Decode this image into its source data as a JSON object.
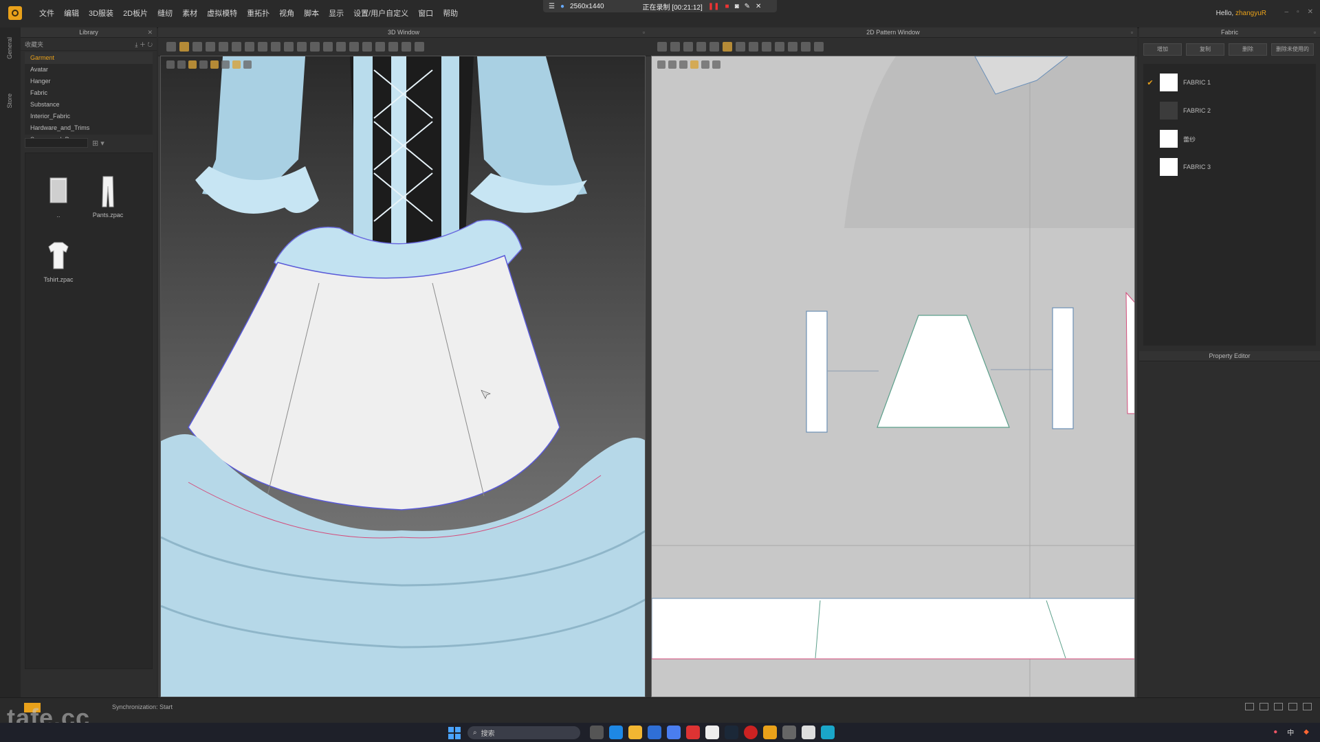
{
  "titlebar": {
    "menu": [
      "文件",
      "编辑",
      "3D服装",
      "2D板片",
      "缝纫",
      "素材",
      "虚拟模特",
      "重拓扑",
      "视角",
      "脚本",
      "显示",
      "设置/用户自定义",
      "窗口",
      "帮助"
    ],
    "recording": {
      "resolution": "2560x1440",
      "status": "正在录制 [00:21:12]"
    },
    "greeting": "Hello,",
    "username": "zhangyuR"
  },
  "left_strip": {
    "tabs": [
      "General",
      "Store"
    ]
  },
  "library": {
    "title": "Library",
    "toolbar_label": "收藏夹",
    "tree": [
      "Garment",
      "Avatar",
      "Hanger",
      "Fabric",
      "Substance",
      "Interior_Fabric",
      "Hardware_and_Trims",
      "Scene_and_Props"
    ],
    "selected": "Garment",
    "files": [
      {
        "name": "..",
        "icon": "folder-icon"
      },
      {
        "name": "Pants.zpac",
        "icon": "pants-icon"
      },
      {
        "name": "Tshirt.zpac",
        "icon": "tshirt-icon"
      }
    ]
  },
  "window3d": {
    "title": "3D Window"
  },
  "window2d": {
    "title": "2D Pattern Window"
  },
  "fabric_panel": {
    "title": "Fabric",
    "buttons": [
      "增加",
      "复制",
      "删除",
      "删除未使用的"
    ],
    "fabrics": [
      {
        "name": "FABRIC 1",
        "checked": true,
        "swatch": "#ffffff"
      },
      {
        "name": "FABRIC 2",
        "checked": false,
        "swatch": "#3c3c3c"
      },
      {
        "name": "蕾纱",
        "checked": false,
        "swatch": "#ffffff"
      },
      {
        "name": "FABRIC 3",
        "checked": false,
        "swatch": "#ffffff"
      }
    ],
    "property_editor_title": "Property Editor"
  },
  "status": {
    "text": "Synchronization: Start"
  },
  "taskbar": {
    "search_placeholder": "搜索",
    "ime": "中"
  },
  "watermark": "tafe.cc",
  "colors": {
    "accent": "#e9a11a",
    "dress": "#b9dcec",
    "pattern_bg": "#c8c8c8"
  }
}
